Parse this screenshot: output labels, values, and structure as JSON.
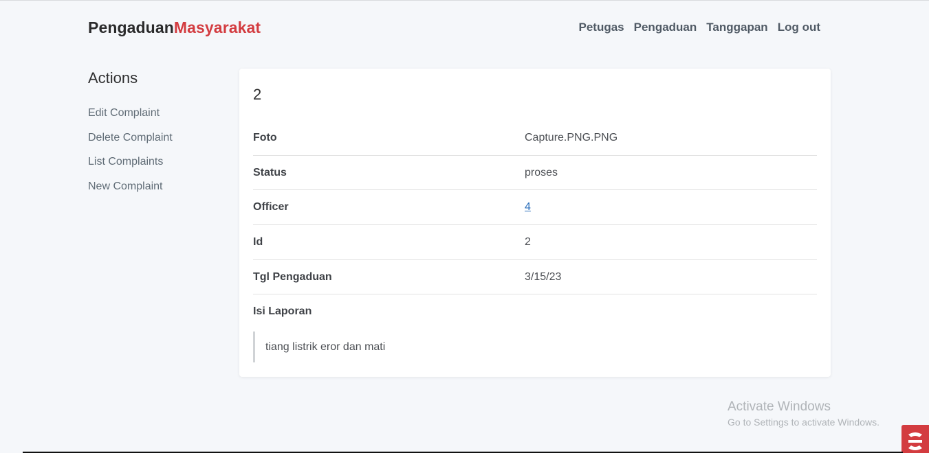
{
  "brand": {
    "part1": "Pengaduan",
    "part2": "Masyarakat"
  },
  "nav": [
    "Petugas",
    "Pengaduan",
    "Tanggapan",
    "Log out"
  ],
  "sidebar": {
    "title": "Actions",
    "items": [
      "Edit Complaint",
      "Delete Complaint",
      "List Complaints",
      "New Complaint"
    ]
  },
  "record": {
    "heading": "2",
    "fields": [
      {
        "label": "Foto",
        "value": "Capture.PNG.PNG"
      },
      {
        "label": "Status",
        "value": "proses"
      },
      {
        "label": "Officer",
        "value": "4"
      },
      {
        "label": "Id",
        "value": "2"
      },
      {
        "label": "Tgl Pengaduan",
        "value": "3/15/23"
      }
    ],
    "laporan_label": "Isi Laporan",
    "laporan_text": "tiang listrik eror dan mati"
  },
  "watermark": {
    "line1": "Activate Windows",
    "line2": "Go to Settings to activate Windows."
  },
  "colors": {
    "accent": "#d33c40",
    "link": "#2a6ebb",
    "background": "#f5f7fa"
  }
}
